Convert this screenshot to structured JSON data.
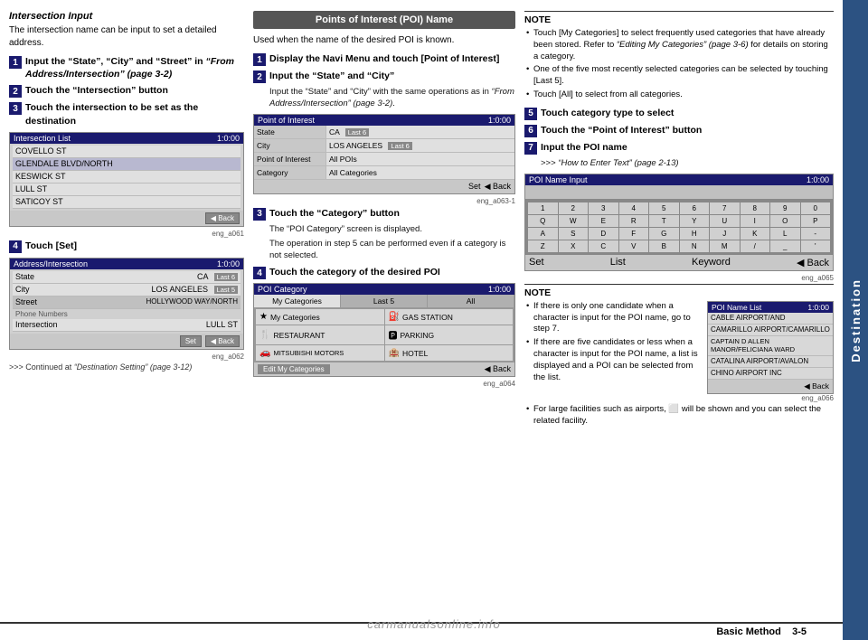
{
  "page": {
    "title": "Basic Method 3-5",
    "tab_label": "Destination"
  },
  "left_col": {
    "section_title": "Intersection Input",
    "intro": "The intersection name can be input to set a detailed address.",
    "steps": [
      {
        "num": "1",
        "text": "Input the “State”, “City” and “Street” in “From Address/Intersection” (page 3-2)"
      },
      {
        "num": "2",
        "text": "Touch the “Intersection” button"
      },
      {
        "num": "3",
        "text": "Touch the intersection to be set as the destination"
      }
    ],
    "screen1": {
      "title": "Intersection List",
      "time": "1:0:00",
      "rows": [
        "COVELLO ST",
        "GLENDALE BLVD/NORTH",
        "KESWICK ST",
        "LULL ST",
        "SATICOY ST"
      ],
      "caption": "eng_a061"
    },
    "step4": {
      "num": "4",
      "text": "Touch [Set]"
    },
    "screen2": {
      "title": "Address/Intersection",
      "time": "1:0:00",
      "rows": [
        {
          "label": "State",
          "value": "CA",
          "badge": "Last 6"
        },
        {
          "label": "City",
          "value": "LOS ANGELES",
          "badge": "Last 5"
        },
        {
          "label": "Street",
          "value": "HOLLYWOOD WAY/NORTH",
          "badge": ""
        },
        {
          "label": "Intersection",
          "value": "LULL ST",
          "badge": ""
        }
      ],
      "caption": "eng_a062"
    },
    "continued": ">>> Continued at “Destination Setting” (page 3-12)"
  },
  "middle_col": {
    "header_box": "Points of Interest (POI) Name",
    "intro": "Used when the name of the desired POI is known.",
    "steps": [
      {
        "num": "1",
        "text": "Display the Navi Menu and touch [Point of Interest]"
      },
      {
        "num": "2",
        "text": "Input the “State” and “City”",
        "sub": "Input the “State” and “City” with the same operations as in “From Address/Intersection” (page 3-2)."
      }
    ],
    "poi_screen": {
      "title": "Point of Interest",
      "time": "1:0:00",
      "rows": [
        {
          "label": "State",
          "value": "CA",
          "badge": "Last 6"
        },
        {
          "label": "City",
          "value": "LOS ANGELES",
          "badge": "Last 6"
        },
        {
          "label": "Point of Interest",
          "value": "All POIs",
          "badge": ""
        },
        {
          "label": "Category",
          "value": "All Categories",
          "badge": ""
        }
      ],
      "caption": "eng_a063-1"
    },
    "step3": {
      "num": "3",
      "text": "Touch the “Category” button",
      "sub1": "The “POI Category” screen is displayed.",
      "sub2": "The operation in step 5 can be performed even if a category is not selected."
    },
    "step4": {
      "num": "4",
      "text": "Touch the category of the desired POI"
    },
    "cat_screen": {
      "title": "POI Category",
      "time": "1:0:00",
      "tabs": [
        "My Categories",
        "Last 5",
        "All"
      ],
      "cells": [
        {
          "icon": "★",
          "label": "My Categories"
        },
        {
          "icon": "⛽",
          "label": "GAS STATION"
        },
        {
          "icon": "🍴",
          "label": "RESTAURANT"
        },
        {
          "icon": "🅿",
          "label": "PARKING"
        },
        {
          "icon": "🏨",
          "label": "HOTEL"
        },
        {
          "icon": "🚗",
          "label": "MITSUBISHI MOTORS"
        }
      ],
      "edit_btn": "Edit My Categories",
      "caption": "eng_a064"
    }
  },
  "right_col": {
    "note1": {
      "title": "NOTE",
      "items": [
        "Touch [My Categories] to select frequently used categories that have already been stored. Refer to “Editing My Categories” (page 3-6) for details on storing a category.",
        "One of the five most recently selected categories can be selected by touching [Last 5].",
        "Touch [All] to select from all categories."
      ]
    },
    "steps": [
      {
        "num": "5",
        "text": "Touch category type to select"
      },
      {
        "num": "6",
        "text": "Touch the “Point of Interest” button"
      },
      {
        "num": "7",
        "text": "Input the POI name",
        "sub": ">>> “How to Enter Text” (page 2-13)"
      }
    ],
    "poi_name_screen": {
      "title": "POI Name Input",
      "time": "1:0:00",
      "keys_row1": [
        "1",
        "2",
        "3",
        "4",
        "5",
        "6",
        "7",
        "8",
        "9",
        "0"
      ],
      "keys_row2": [
        "Q",
        "W",
        "E",
        "R",
        "T",
        "Y",
        "U",
        "I",
        "O",
        "P"
      ],
      "keys_row3": [
        "A",
        "S",
        "D",
        "F",
        "G",
        "H",
        "J",
        "K",
        "L",
        "-"
      ],
      "keys_row4": [
        "Z",
        "X",
        "C",
        "V",
        "B",
        "N",
        "M",
        "/",
        "_",
        "'"
      ],
      "btns": [
        "Set",
        "List",
        "Keyword",
        "Back"
      ],
      "caption": "eng_a065"
    },
    "note2": {
      "title": "NOTE",
      "items": [
        "If there is only one candidate when a character is input for the POI name, go to step 7.",
        "If there are five candidates or less when a character is input for the POI name, a list is displayed and a POI can be selected from the list.",
        "For large facilities such as airports, ⬜ will be shown and you can select the related facility."
      ]
    },
    "poi_list_screen": {
      "title": "POI Name List",
      "time": "1:0:00",
      "rows": [
        "CABLE AIRPORT/AND",
        "CAMARILLO AIRPORT/CAMARILLO",
        "CAPTAIN D ALLEN MANOR/FELICIANA WARD",
        "CATALINA AIRPORT/AVALON",
        "CHINO AIRPORT INC"
      ],
      "caption": "eng_a066"
    }
  },
  "bottom": {
    "label": "Basic Method",
    "page": "3-5"
  }
}
